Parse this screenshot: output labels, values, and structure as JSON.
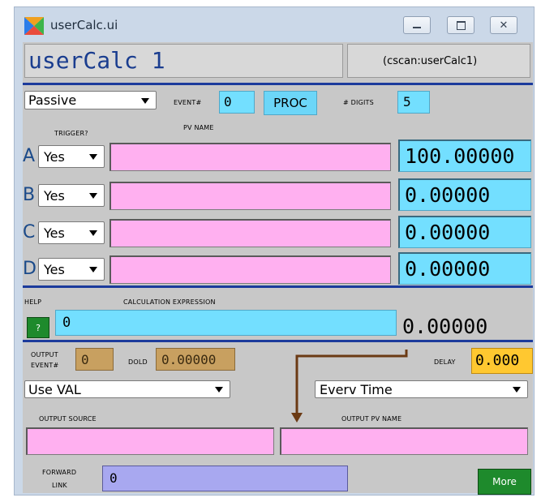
{
  "window": {
    "title": "userCalc.ui",
    "controls": [
      "minimize",
      "maximize",
      "close"
    ]
  },
  "header": {
    "name": "userCalc 1",
    "pv": "(cscan:userCalc1)"
  },
  "top_row": {
    "scan_mode": "Passive",
    "event_label": "EVENT#",
    "event_value": "0",
    "proc_label": "PROC",
    "digits_label": "# DIGITS",
    "digits_value": "5"
  },
  "inputs": {
    "trigger_header": "TRIGGER?",
    "pvname_header": "PV NAME",
    "rows": [
      {
        "letter": "A",
        "trigger": "Yes",
        "pv": "",
        "value": "100.00000"
      },
      {
        "letter": "B",
        "trigger": "Yes",
        "pv": "",
        "value": "0.00000"
      },
      {
        "letter": "C",
        "trigger": "Yes",
        "pv": "",
        "value": "0.00000"
      },
      {
        "letter": "D",
        "trigger": "Yes",
        "pv": "",
        "value": "0.00000"
      }
    ]
  },
  "calc": {
    "help_label": "HELP",
    "help_button": "?",
    "expr_label": "CALCULATION EXPRESSION",
    "expression": "0",
    "result": "0.00000"
  },
  "output": {
    "event_label_1": "OUTPUT",
    "event_label_2": "EVENT#",
    "event_value": "0",
    "dold_label": "DOLD",
    "dold_value": "0.00000",
    "delay_label": "DELAY",
    "delay_value": "0.000",
    "use_select": "Use VAL",
    "when_select": "Everv Time",
    "source_label": "OUTPUT SOURCE",
    "source_value": "",
    "pvname_label": "OUTPUT PV NAME",
    "pvname_value": ""
  },
  "footer": {
    "forward_label_1": "FORWARD",
    "forward_label_2": "LINK",
    "forward_value": "0",
    "more_button": "More"
  },
  "colors": {
    "entry_blue": "#73dfff",
    "pv_pink": "#ffb0f0",
    "separator": "#1c3b9c",
    "gold": "#c8a060",
    "more_green": "#1e8a2c"
  }
}
